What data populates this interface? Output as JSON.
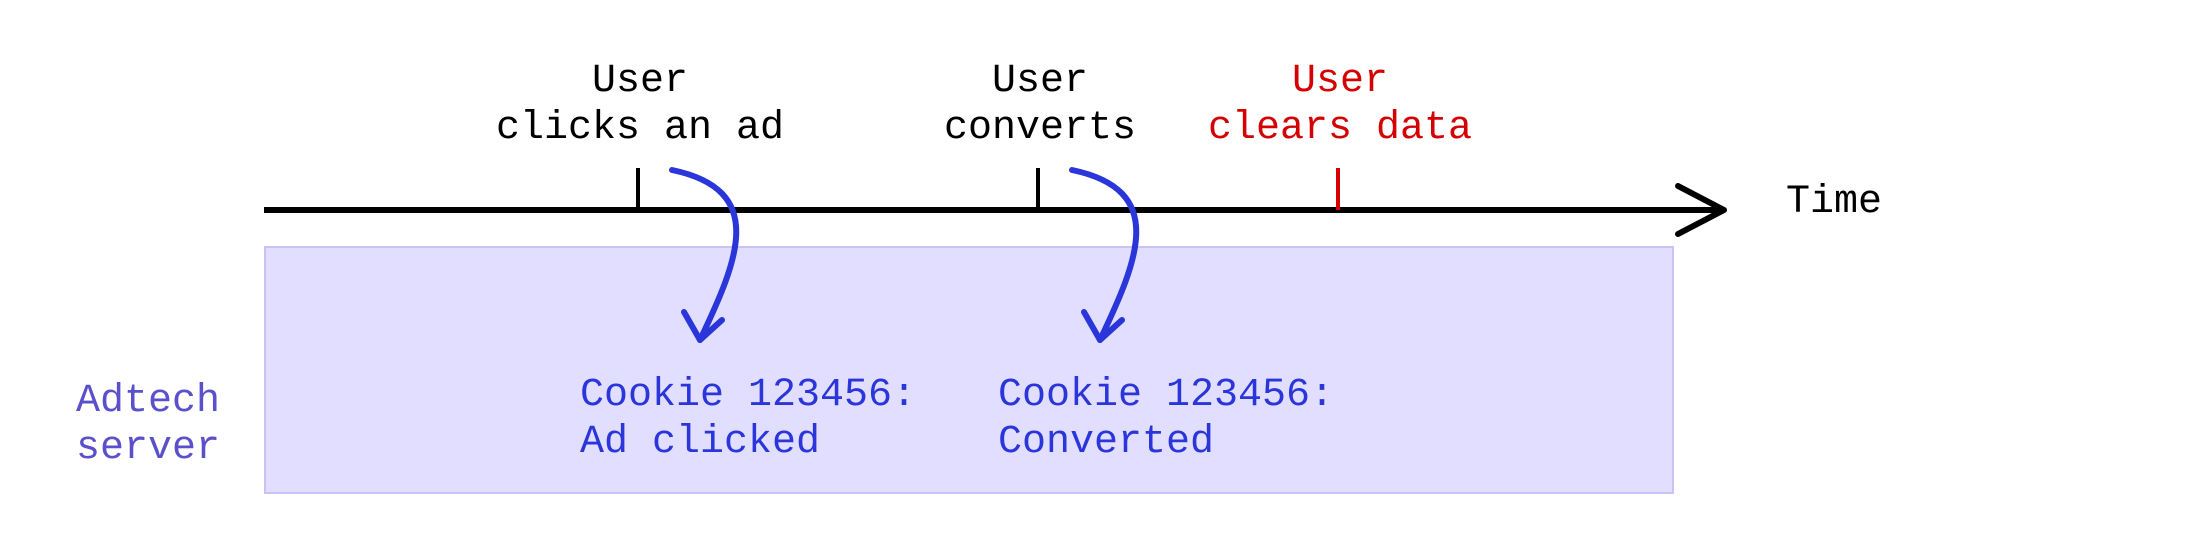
{
  "axis_label": "Time",
  "server_label": "Adtech\nserver",
  "events": {
    "click": {
      "label": "User\nclicks an ad",
      "color": "black"
    },
    "convert": {
      "label": "User\nconverts",
      "color": "black"
    },
    "clear": {
      "label": "User\nclears data",
      "color": "red"
    }
  },
  "records": {
    "click": "Cookie 123456:\nAd clicked",
    "convert": "Cookie 123456:\nConverted"
  },
  "colors": {
    "axis": "#000000",
    "tick_black": "#000000",
    "tick_red": "#d40202",
    "arrow_blue": "#2a36d9",
    "box_fill": "#e1deff",
    "box_border": "#c8c2f5",
    "purple": "#5a50cc"
  }
}
